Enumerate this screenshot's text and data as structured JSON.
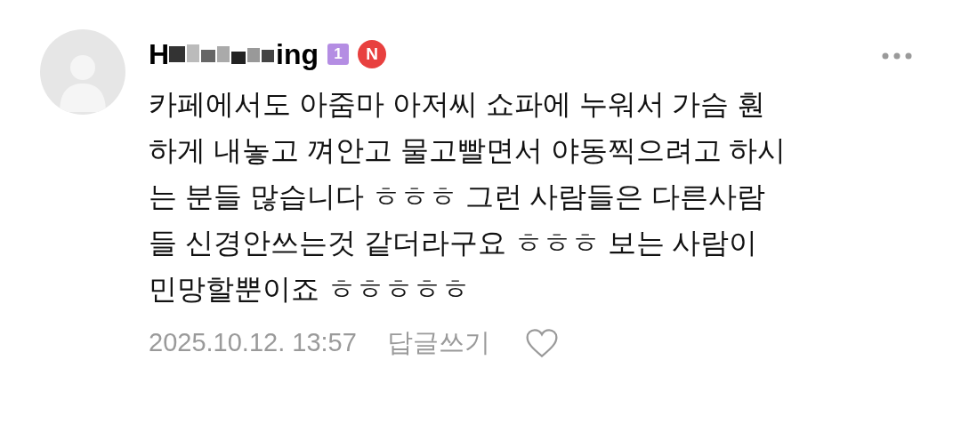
{
  "comment": {
    "author": {
      "name_start": "H",
      "name_end": "ing",
      "level_badge": "1",
      "new_badge": "N"
    },
    "body_lines": [
      "카페에서도 아줌마 아저씨 쇼파에 누워서 가슴 훤",
      "하게 내놓고 껴안고 물고빨면서 야동찍으려고 하시",
      "는 분들 많습니다 ㅎㅎㅎ 그런 사람들은 다른사람",
      "들 신경안쓰는것 같더라구요 ㅎㅎㅎ 보는 사람이",
      "민망할뿐이죠 ㅎㅎㅎㅎㅎ"
    ],
    "timestamp": "2025.10.12. 13:57",
    "reply_label": "답글쓰기",
    "liked": false
  }
}
